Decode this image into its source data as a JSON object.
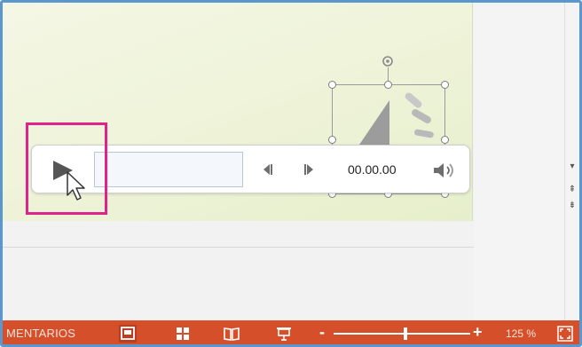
{
  "media_player": {
    "time_display": "00.00.00",
    "progress_value": 0
  },
  "statusbar": {
    "comments_label": "MENTARIOS",
    "zoom_level": "125 %",
    "zoom_minus": "-",
    "zoom_plus": "+"
  },
  "scrollbar": {
    "down_arrow": "▾",
    "prev_slide": "⇞",
    "next_slide": "⇟"
  },
  "colors": {
    "statusbar_bg": "#d64f2b",
    "highlight": "#e0228a",
    "frame_border": "#5b97cf",
    "slide_bg": "#eef3d8"
  },
  "icons": [
    "play-icon",
    "mouse-pointer-icon",
    "step-back-icon",
    "step-forward-icon",
    "volume-icon",
    "speaker-icon",
    "rotate-handle-icon",
    "normal-view-icon",
    "slide-sorter-icon",
    "reading-view-icon",
    "slideshow-icon",
    "fit-to-window-icon"
  ]
}
